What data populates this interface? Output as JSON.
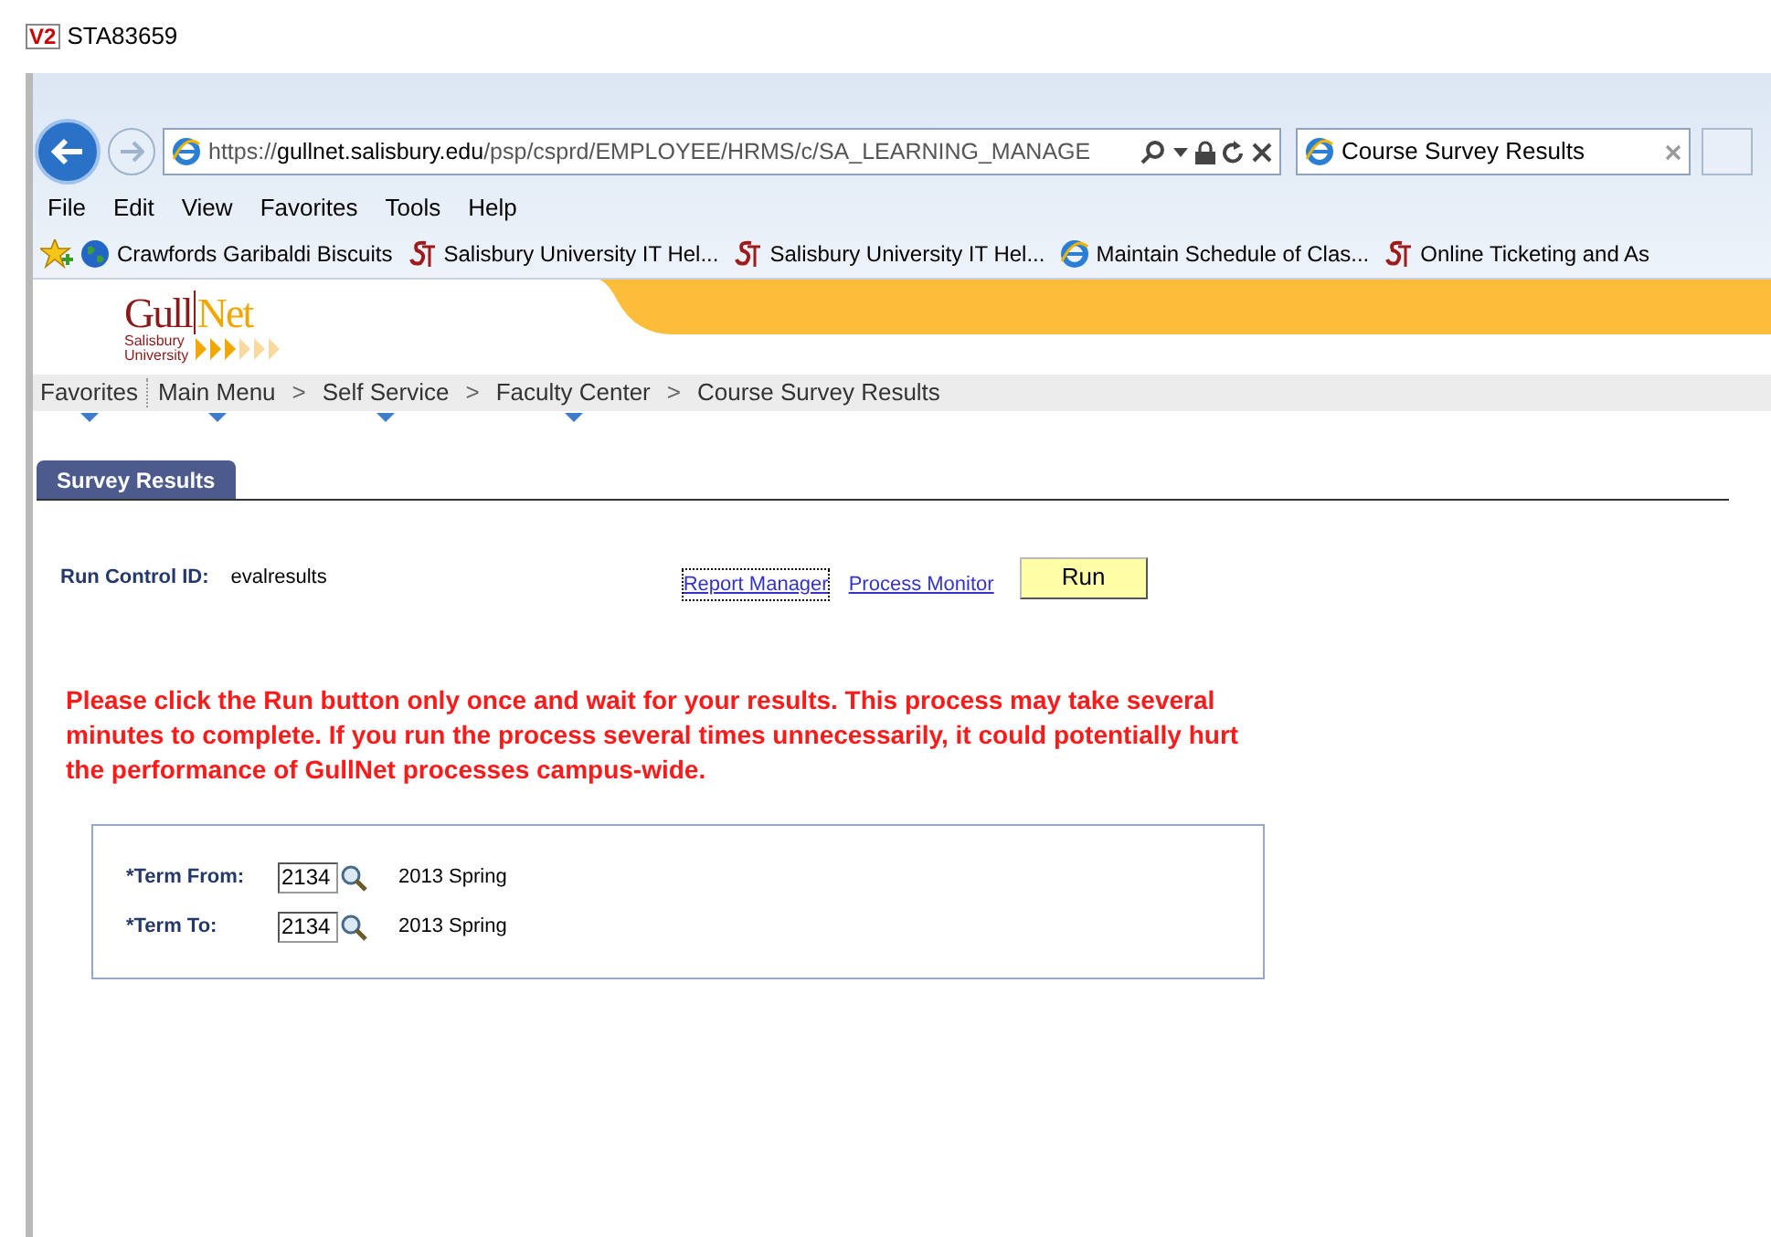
{
  "outer_window": {
    "title": "STA83659",
    "logo": "V2"
  },
  "browser": {
    "address": {
      "scheme": "https://",
      "host": "gullnet.salisbury.edu",
      "path": "/psp/csprd/EMPLOYEE/HRMS/c/SA_LEARNING_MANAGE"
    },
    "tab": {
      "title": "Course Survey Results",
      "selected": true
    },
    "menu": [
      "File",
      "Edit",
      "View",
      "Favorites",
      "Tools",
      "Help"
    ],
    "favorites_bar": [
      {
        "kind": "globe",
        "label": "Crawfords Garibaldi Biscuits"
      },
      {
        "kind": "su",
        "label": "Salisbury University IT Hel..."
      },
      {
        "kind": "su",
        "label": "Salisbury University IT Hel..."
      },
      {
        "kind": "ie",
        "label": "Maintain Schedule of Clas..."
      },
      {
        "kind": "su",
        "label": "Online Ticketing and As"
      }
    ]
  },
  "logo": {
    "part_1": "Gull",
    "part_2": "Net",
    "line_1": "Salisbury",
    "line_2": "University"
  },
  "breadcrumbs": [
    {
      "label": "Favorites",
      "has_menu": true
    },
    {
      "label": "Main Menu",
      "has_menu": true
    },
    {
      "separator_before": ">",
      "label": "Self Service",
      "has_menu": true
    },
    {
      "separator_before": ">",
      "label": "Faculty Center",
      "has_menu": true
    },
    {
      "separator_before": ">",
      "label": "Course Survey Results",
      "has_menu": false
    }
  ],
  "page_tabs": [
    {
      "label": "Survey Results",
      "selected": true
    }
  ],
  "run_control": {
    "label": "Run Control ID:",
    "value": "evalresults"
  },
  "links": [
    {
      "label": "Report Manager",
      "focused": true
    },
    {
      "label": "Process Monitor",
      "focused": false
    }
  ],
  "run_button": "Run",
  "warning": "Please click the Run button only once and wait for your results. This process may take several minutes to complete. If you run the process several times unnecessarily, it could potentially hurt the performance of GullNet processes campus-wide.",
  "fields": [
    {
      "label": "*Term From:",
      "value": "2134",
      "description": "2013 Spring"
    },
    {
      "label": "*Term To:",
      "value": "2134",
      "description": "2013 Spring"
    }
  ]
}
